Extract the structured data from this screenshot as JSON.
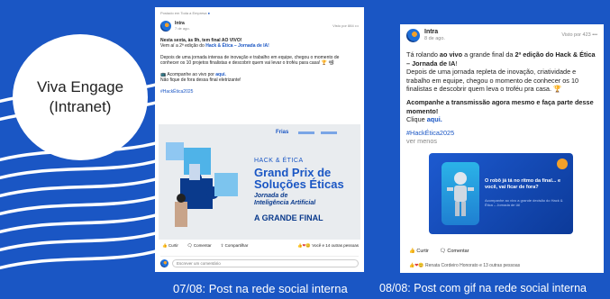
{
  "label": {
    "line1": "Viva Engage",
    "line2": "(Intranet)"
  },
  "post1": {
    "posted_in": "Postado em Toda a Empresa",
    "author": "Intra",
    "time": "7 de ago.",
    "views": "Visto por 884",
    "line_bold": "Nesta sexta, às 9h, tem final AO VIVO!",
    "line2_a": "Vem aí a 2ª edição do ",
    "line2_link": "Hack & Ética – Jornada de IA!",
    "body": "Depois de uma jornada intensa de inovação e trabalho em equipe, chegou o momento de conhecer os 10 projetos finalistas e descobrir quem vai levar o troféu para casa! 🏆 📽",
    "watch_a": "📺 Acompanhe ao vivo por ",
    "watch_link": "aqui.",
    "watch_b": "Não fique de fora dessa final eletrizante!",
    "hashtag": "#HackÉtica2025",
    "img_kicker": "HACK & ÉTICA",
    "img_title1": "Grand Prix de",
    "img_title2": "Soluções Éticas",
    "img_sub1": "Jornada de",
    "img_sub2": "Inteligência Artificial",
    "img_final": "A GRANDE FINAL",
    "img_logo": "Frias",
    "like": "Curtir",
    "comment": "Comentar",
    "share": "Compartilhar",
    "reactions": "Você e 14 outras pessoas",
    "write": "Escrever um comentário"
  },
  "post2": {
    "author": "Intra",
    "time": "8 de ago.",
    "views": "Visto por 423",
    "l1_a": "Tá rolando ",
    "l1_b": "ao vivo",
    "l1_c": " a grande final da ",
    "l1_d": "2ª edição do Hack & Ética – Jornada de IA",
    "l1_e": "!",
    "body": "Depois de uma jornada repleta de inovação, criatividade e trabalho em equipe, chegou o momento de conhecer os 10 finalistas e descobrir quem leva o troféu pra casa. 🏆",
    "cta": "Acompanhe a transmissão agora mesmo e faça parte desse momento!",
    "click_a": "Clique ",
    "click_link": "aqui.",
    "hashtag": "#HackÉtica2025",
    "see_less": "ver menos",
    "gif_text": "O robô já tá no ritmo da final... e você, vai ficar de fora?",
    "gif_sub": "Acompanhe ao vivo a grande decisão do Hack & Ética – Jornada de IA!",
    "like": "Curtir",
    "comment": "Comentar",
    "reactions": "Renata Cordeiro Honorato e 13 outras pessoas"
  },
  "captions": {
    "c1": "07/08: Post na rede social interna",
    "c2": "08/08: Post com gif na rede social interna"
  },
  "colors": {
    "background": "#1a56c4",
    "link": "#1a56c4",
    "accent_orange": "#f2a02a"
  }
}
